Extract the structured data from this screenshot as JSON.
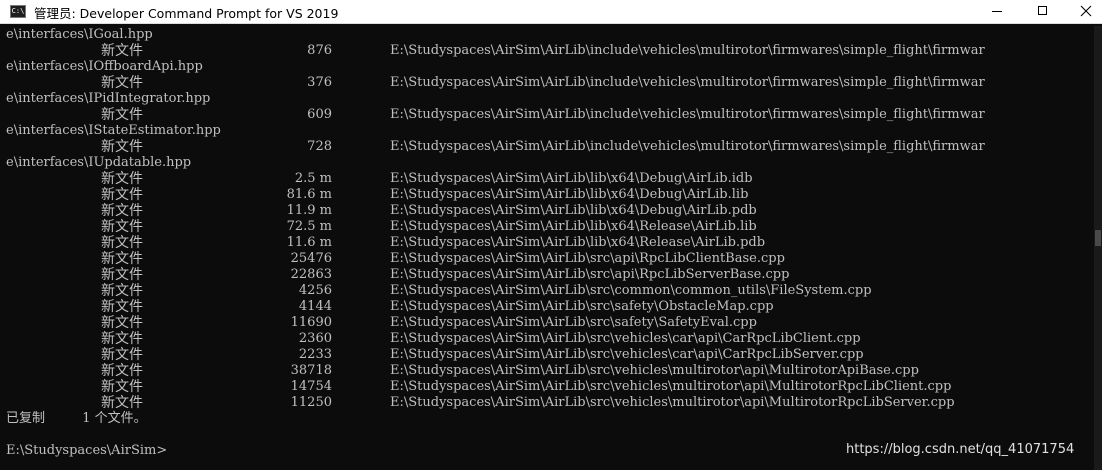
{
  "window": {
    "title": "管理员: Developer Command Prompt for VS 2019",
    "icon": "cmd-icon",
    "icon_glyph": "C:\\",
    "controls": {
      "minimize": "minimize-icon",
      "maximize": "maximize-icon",
      "close": "close-icon"
    }
  },
  "console": {
    "lines": [
      {
        "type": "text",
        "text": "e\\interfaces\\IGoal.hpp"
      },
      {
        "type": "file",
        "status": "新文件",
        "size": "876",
        "path": "E:\\Studyspaces\\AirSim\\AirLib\\include\\vehicles\\multirotor\\firmwares\\simple_flight\\firmwar"
      },
      {
        "type": "text",
        "text": "e\\interfaces\\IOffboardApi.hpp"
      },
      {
        "type": "file",
        "status": "新文件",
        "size": "376",
        "path": "E:\\Studyspaces\\AirSim\\AirLib\\include\\vehicles\\multirotor\\firmwares\\simple_flight\\firmwar"
      },
      {
        "type": "text",
        "text": "e\\interfaces\\IPidIntegrator.hpp"
      },
      {
        "type": "file",
        "status": "新文件",
        "size": "609",
        "path": "E:\\Studyspaces\\AirSim\\AirLib\\include\\vehicles\\multirotor\\firmwares\\simple_flight\\firmwar"
      },
      {
        "type": "text",
        "text": "e\\interfaces\\IStateEstimator.hpp"
      },
      {
        "type": "file",
        "status": "新文件",
        "size": "728",
        "path": "E:\\Studyspaces\\AirSim\\AirLib\\include\\vehicles\\multirotor\\firmwares\\simple_flight\\firmwar"
      },
      {
        "type": "text",
        "text": "e\\interfaces\\IUpdatable.hpp"
      },
      {
        "type": "file",
        "status": "新文件",
        "size": "2.5 m",
        "path": "E:\\Studyspaces\\AirSim\\AirLib\\lib\\x64\\Debug\\AirLib.idb"
      },
      {
        "type": "file",
        "status": "新文件",
        "size": "81.6 m",
        "path": "E:\\Studyspaces\\AirSim\\AirLib\\lib\\x64\\Debug\\AirLib.lib"
      },
      {
        "type": "file",
        "status": "新文件",
        "size": "11.9 m",
        "path": "E:\\Studyspaces\\AirSim\\AirLib\\lib\\x64\\Debug\\AirLib.pdb"
      },
      {
        "type": "file",
        "status": "新文件",
        "size": "72.5 m",
        "path": "E:\\Studyspaces\\AirSim\\AirLib\\lib\\x64\\Release\\AirLib.lib"
      },
      {
        "type": "file",
        "status": "新文件",
        "size": "11.6 m",
        "path": "E:\\Studyspaces\\AirSim\\AirLib\\lib\\x64\\Release\\AirLib.pdb"
      },
      {
        "type": "file",
        "status": "新文件",
        "size": "25476",
        "path": "E:\\Studyspaces\\AirSim\\AirLib\\src\\api\\RpcLibClientBase.cpp"
      },
      {
        "type": "file",
        "status": "新文件",
        "size": "22863",
        "path": "E:\\Studyspaces\\AirSim\\AirLib\\src\\api\\RpcLibServerBase.cpp"
      },
      {
        "type": "file",
        "status": "新文件",
        "size": "4256",
        "path": "E:\\Studyspaces\\AirSim\\AirLib\\src\\common\\common_utils\\FileSystem.cpp"
      },
      {
        "type": "file",
        "status": "新文件",
        "size": "4144",
        "path": "E:\\Studyspaces\\AirSim\\AirLib\\src\\safety\\ObstacleMap.cpp"
      },
      {
        "type": "file",
        "status": "新文件",
        "size": "11690",
        "path": "E:\\Studyspaces\\AirSim\\AirLib\\src\\safety\\SafetyEval.cpp"
      },
      {
        "type": "file",
        "status": "新文件",
        "size": "2360",
        "path": "E:\\Studyspaces\\AirSim\\AirLib\\src\\vehicles\\car\\api\\CarRpcLibClient.cpp"
      },
      {
        "type": "file",
        "status": "新文件",
        "size": "2233",
        "path": "E:\\Studyspaces\\AirSim\\AirLib\\src\\vehicles\\car\\api\\CarRpcLibServer.cpp"
      },
      {
        "type": "file",
        "status": "新文件",
        "size": "38718",
        "path": "E:\\Studyspaces\\AirSim\\AirLib\\src\\vehicles\\multirotor\\api\\MultirotorApiBase.cpp"
      },
      {
        "type": "file",
        "status": "新文件",
        "size": "14754",
        "path": "E:\\Studyspaces\\AirSim\\AirLib\\src\\vehicles\\multirotor\\api\\MultirotorRpcLibClient.cpp"
      },
      {
        "type": "file",
        "status": "新文件",
        "size": "11250",
        "path": "E:\\Studyspaces\\AirSim\\AirLib\\src\\vehicles\\multirotor\\api\\MultirotorRpcLibServer.cpp"
      },
      {
        "type": "text",
        "text": "已复制         1 个文件。"
      },
      {
        "type": "text",
        "text": ""
      },
      {
        "type": "prompt",
        "text": "E:\\Studyspaces\\AirSim>"
      }
    ]
  },
  "watermark": "https://blog.csdn.net/qq_41071754",
  "colors": {
    "console_bg": "#0c0c0c",
    "console_fg": "#c0c0c0",
    "titlebar_bg": "#ffffff"
  }
}
